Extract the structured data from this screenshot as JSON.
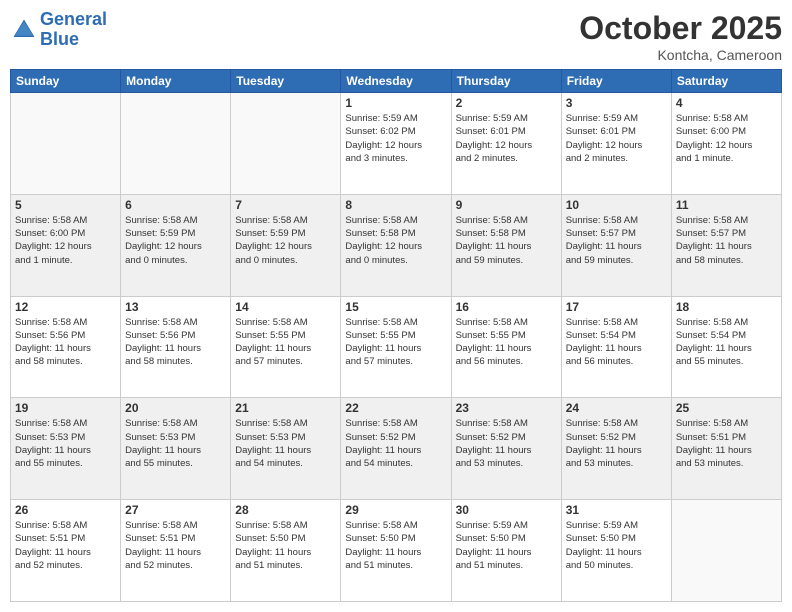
{
  "header": {
    "logo_line1": "General",
    "logo_line2": "Blue",
    "month": "October 2025",
    "location": "Kontcha, Cameroon"
  },
  "days_of_week": [
    "Sunday",
    "Monday",
    "Tuesday",
    "Wednesday",
    "Thursday",
    "Friday",
    "Saturday"
  ],
  "weeks": [
    {
      "shaded": false,
      "days": [
        {
          "num": "",
          "info": ""
        },
        {
          "num": "",
          "info": ""
        },
        {
          "num": "",
          "info": ""
        },
        {
          "num": "1",
          "info": "Sunrise: 5:59 AM\nSunset: 6:02 PM\nDaylight: 12 hours\nand 3 minutes."
        },
        {
          "num": "2",
          "info": "Sunrise: 5:59 AM\nSunset: 6:01 PM\nDaylight: 12 hours\nand 2 minutes."
        },
        {
          "num": "3",
          "info": "Sunrise: 5:59 AM\nSunset: 6:01 PM\nDaylight: 12 hours\nand 2 minutes."
        },
        {
          "num": "4",
          "info": "Sunrise: 5:58 AM\nSunset: 6:00 PM\nDaylight: 12 hours\nand 1 minute."
        }
      ]
    },
    {
      "shaded": true,
      "days": [
        {
          "num": "5",
          "info": "Sunrise: 5:58 AM\nSunset: 6:00 PM\nDaylight: 12 hours\nand 1 minute."
        },
        {
          "num": "6",
          "info": "Sunrise: 5:58 AM\nSunset: 5:59 PM\nDaylight: 12 hours\nand 0 minutes."
        },
        {
          "num": "7",
          "info": "Sunrise: 5:58 AM\nSunset: 5:59 PM\nDaylight: 12 hours\nand 0 minutes."
        },
        {
          "num": "8",
          "info": "Sunrise: 5:58 AM\nSunset: 5:58 PM\nDaylight: 12 hours\nand 0 minutes."
        },
        {
          "num": "9",
          "info": "Sunrise: 5:58 AM\nSunset: 5:58 PM\nDaylight: 11 hours\nand 59 minutes."
        },
        {
          "num": "10",
          "info": "Sunrise: 5:58 AM\nSunset: 5:57 PM\nDaylight: 11 hours\nand 59 minutes."
        },
        {
          "num": "11",
          "info": "Sunrise: 5:58 AM\nSunset: 5:57 PM\nDaylight: 11 hours\nand 58 minutes."
        }
      ]
    },
    {
      "shaded": false,
      "days": [
        {
          "num": "12",
          "info": "Sunrise: 5:58 AM\nSunset: 5:56 PM\nDaylight: 11 hours\nand 58 minutes."
        },
        {
          "num": "13",
          "info": "Sunrise: 5:58 AM\nSunset: 5:56 PM\nDaylight: 11 hours\nand 58 minutes."
        },
        {
          "num": "14",
          "info": "Sunrise: 5:58 AM\nSunset: 5:55 PM\nDaylight: 11 hours\nand 57 minutes."
        },
        {
          "num": "15",
          "info": "Sunrise: 5:58 AM\nSunset: 5:55 PM\nDaylight: 11 hours\nand 57 minutes."
        },
        {
          "num": "16",
          "info": "Sunrise: 5:58 AM\nSunset: 5:55 PM\nDaylight: 11 hours\nand 56 minutes."
        },
        {
          "num": "17",
          "info": "Sunrise: 5:58 AM\nSunset: 5:54 PM\nDaylight: 11 hours\nand 56 minutes."
        },
        {
          "num": "18",
          "info": "Sunrise: 5:58 AM\nSunset: 5:54 PM\nDaylight: 11 hours\nand 55 minutes."
        }
      ]
    },
    {
      "shaded": true,
      "days": [
        {
          "num": "19",
          "info": "Sunrise: 5:58 AM\nSunset: 5:53 PM\nDaylight: 11 hours\nand 55 minutes."
        },
        {
          "num": "20",
          "info": "Sunrise: 5:58 AM\nSunset: 5:53 PM\nDaylight: 11 hours\nand 55 minutes."
        },
        {
          "num": "21",
          "info": "Sunrise: 5:58 AM\nSunset: 5:53 PM\nDaylight: 11 hours\nand 54 minutes."
        },
        {
          "num": "22",
          "info": "Sunrise: 5:58 AM\nSunset: 5:52 PM\nDaylight: 11 hours\nand 54 minutes."
        },
        {
          "num": "23",
          "info": "Sunrise: 5:58 AM\nSunset: 5:52 PM\nDaylight: 11 hours\nand 53 minutes."
        },
        {
          "num": "24",
          "info": "Sunrise: 5:58 AM\nSunset: 5:52 PM\nDaylight: 11 hours\nand 53 minutes."
        },
        {
          "num": "25",
          "info": "Sunrise: 5:58 AM\nSunset: 5:51 PM\nDaylight: 11 hours\nand 53 minutes."
        }
      ]
    },
    {
      "shaded": false,
      "days": [
        {
          "num": "26",
          "info": "Sunrise: 5:58 AM\nSunset: 5:51 PM\nDaylight: 11 hours\nand 52 minutes."
        },
        {
          "num": "27",
          "info": "Sunrise: 5:58 AM\nSunset: 5:51 PM\nDaylight: 11 hours\nand 52 minutes."
        },
        {
          "num": "28",
          "info": "Sunrise: 5:58 AM\nSunset: 5:50 PM\nDaylight: 11 hours\nand 51 minutes."
        },
        {
          "num": "29",
          "info": "Sunrise: 5:58 AM\nSunset: 5:50 PM\nDaylight: 11 hours\nand 51 minutes."
        },
        {
          "num": "30",
          "info": "Sunrise: 5:59 AM\nSunset: 5:50 PM\nDaylight: 11 hours\nand 51 minutes."
        },
        {
          "num": "31",
          "info": "Sunrise: 5:59 AM\nSunset: 5:50 PM\nDaylight: 11 hours\nand 50 minutes."
        },
        {
          "num": "",
          "info": ""
        }
      ]
    }
  ]
}
